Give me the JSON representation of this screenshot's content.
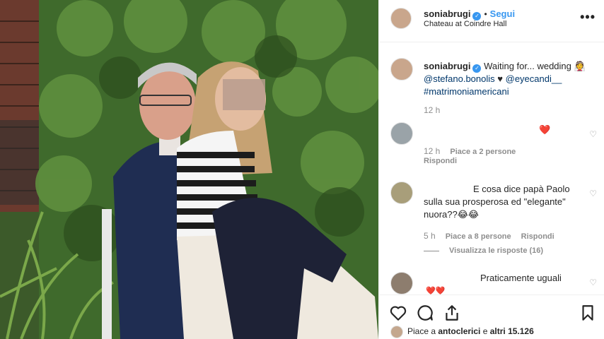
{
  "post": {
    "username": "soniabrugi",
    "verified_mark": "✓",
    "follow_label": "Segui",
    "location": "Chateau at Coindre Hall",
    "more_icon": "more-options-icon"
  },
  "caption": {
    "username": "soniabrugi",
    "text_1": "Waiting for... wedding",
    "emoji_1": "👰",
    "mention_1": "@stefano.bonolis",
    "heart": "♥",
    "mention_2": "@eyecandi__",
    "hashtag": "#matrimoniamericani",
    "time": "12 h"
  },
  "comments": [
    {
      "text": "❤️",
      "time": "12 h",
      "likes": "Piace a 2 persone",
      "reply": "Rispondi"
    },
    {
      "text_line1": "E cosa dice papà Paolo",
      "text_line2": "sulla sua prosperosa ed \"elegante\"",
      "text_line3": "nuora??😂😂",
      "time": "5 h",
      "likes": "Piace a 8 persone",
      "reply": "Rispondi",
      "view_replies": "Visualizza le risposte (16)"
    },
    {
      "text": "Praticamente uguali",
      "emoji": "❤️❤️"
    }
  ],
  "footer": {
    "likes_prefix": "Piace a ",
    "likes_user": "antoclerici",
    "likes_mid": " e ",
    "likes_others": "altri 15.126"
  },
  "colors": {
    "accent": "#3897f0",
    "heart_red": "#ed4956"
  }
}
